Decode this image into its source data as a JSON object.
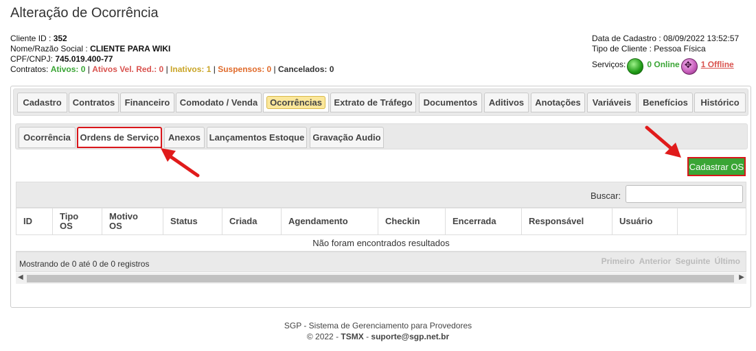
{
  "page": {
    "title": "Alteração de Ocorrência"
  },
  "client": {
    "id_label": "Cliente ID : ",
    "id": "352",
    "name_label": "Nome/Razão Social : ",
    "name": "CLIENTE PARA WIKI",
    "doc_label": "CPF/CNPJ: ",
    "doc": "745.019.400-77",
    "contracts_label": "Contratos: ",
    "ativos": "Ativos: 0",
    "ativos_vel": "Ativos Vel. Red.: 0",
    "inativos": "Inativos: 1",
    "suspensos": "Suspensos: 0",
    "cancelados": "Cancelados: 0",
    "sep": " | "
  },
  "client_right": {
    "date": "Data de Cadastro : 08/09/2022 13:52:57",
    "type": "Tipo de Cliente : Pessoa Física",
    "services_label": "Serviços:",
    "online": "0 Online",
    "offline": "1 Offline"
  },
  "colors": {
    "accent_green": "#3aa535",
    "alert_red": "#d9151a",
    "highlight": "#fbe79b"
  },
  "main_tabs": [
    {
      "label": "Cadastro"
    },
    {
      "label": "Contratos"
    },
    {
      "label": "Financeiro"
    },
    {
      "label": "Comodato / Venda"
    },
    {
      "label": "Ocorrências"
    },
    {
      "label": "Extrato de Tráfego"
    },
    {
      "label": "Documentos"
    },
    {
      "label": "Aditivos"
    },
    {
      "label": "Anotações"
    },
    {
      "label": "Variáveis"
    },
    {
      "label": "Benefícios"
    },
    {
      "label": "Histórico"
    }
  ],
  "sub_tabs": [
    {
      "label": "Ocorrência"
    },
    {
      "label": "Ordens de Serviço"
    },
    {
      "label": "Anexos"
    },
    {
      "label": "Lançamentos Estoque"
    },
    {
      "label": "Gravação Audio"
    }
  ],
  "actions": {
    "cadastrar_os": "Cadastrar OS"
  },
  "table": {
    "search_label": "Buscar:",
    "columns": [
      {
        "line1": "ID",
        "line2": ""
      },
      {
        "line1": "Tipo",
        "line2": "OS"
      },
      {
        "line1": "Motivo",
        "line2": "OS"
      },
      {
        "line1": "Status",
        "line2": ""
      },
      {
        "line1": "Criada",
        "line2": ""
      },
      {
        "line1": "Agendamento",
        "line2": ""
      },
      {
        "line1": "Checkin",
        "line2": ""
      },
      {
        "line1": "Encerrada",
        "line2": ""
      },
      {
        "line1": "Responsável",
        "line2": ""
      },
      {
        "line1": "Usuário",
        "line2": ""
      }
    ],
    "empty_message": "Não foram encontrados resultados",
    "showing": "Mostrando de 0 até 0 de 0 registros",
    "pager": {
      "first": "Primeiro",
      "prev": "Anterior",
      "next": "Seguinte",
      "last": "Último"
    }
  },
  "footer": {
    "line1": "SGP - Sistema de Gerenciamento para Provedores",
    "copyright": "© 2022 - ",
    "company": "TSMX",
    "dash": " - ",
    "email": "suporte@sgp.net.br"
  }
}
